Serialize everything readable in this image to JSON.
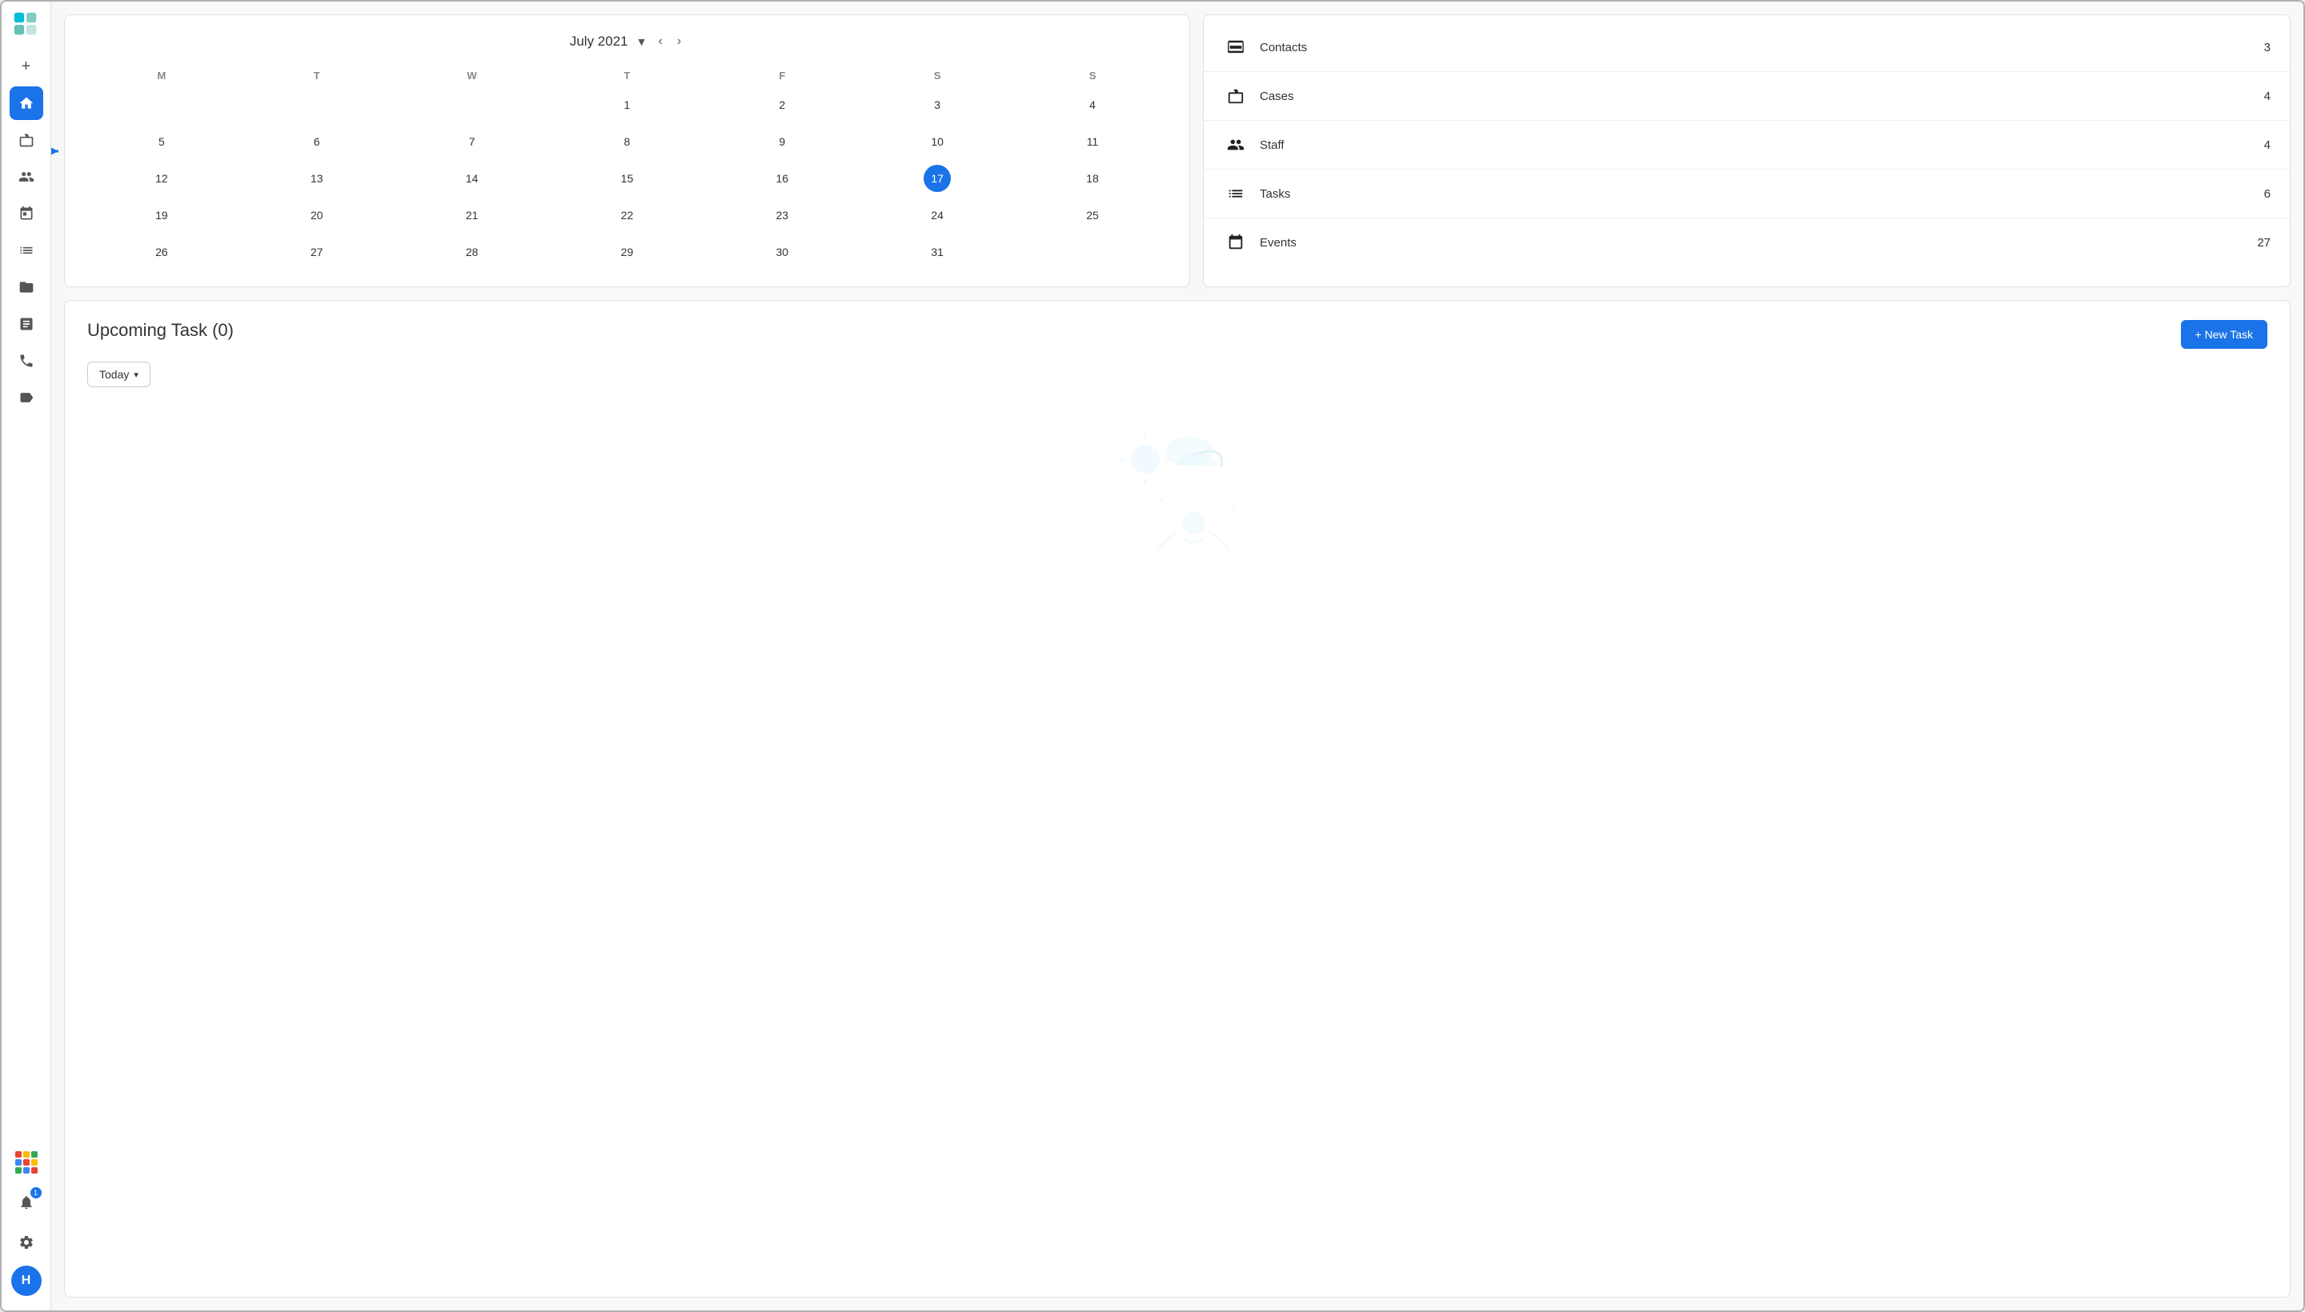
{
  "app": {
    "logo_alt": "App Logo"
  },
  "sidebar": {
    "items": [
      {
        "id": "add",
        "icon": "+",
        "label": "Add",
        "active": false
      },
      {
        "id": "home",
        "icon": "⌂",
        "label": "Home",
        "active": true
      },
      {
        "id": "briefcase",
        "icon": "💼",
        "label": "Briefcase",
        "active": false
      },
      {
        "id": "contacts",
        "icon": "👥",
        "label": "Contacts",
        "active": false
      },
      {
        "id": "calendar",
        "icon": "📅",
        "label": "Calendar",
        "active": false
      },
      {
        "id": "tasks",
        "icon": "☰",
        "label": "Tasks",
        "active": false
      },
      {
        "id": "folder",
        "icon": "📁",
        "label": "Folder",
        "active": false
      },
      {
        "id": "notes",
        "icon": "📋",
        "label": "Notes",
        "active": false
      },
      {
        "id": "phone",
        "icon": "📞",
        "label": "Phone",
        "active": false
      },
      {
        "id": "tag",
        "icon": "🏷",
        "label": "Tag",
        "active": false
      }
    ],
    "bottom": {
      "grid_label": "Apps Grid",
      "notification_label": "Notifications",
      "notification_count": "1",
      "settings_label": "Settings",
      "avatar_label": "H",
      "avatar_letter": "H"
    }
  },
  "calendar": {
    "title": "July 2021",
    "dropdown_arrow": "▼",
    "nav_prev": "‹",
    "nav_next": "›",
    "day_headers": [
      "M",
      "T",
      "W",
      "T",
      "F",
      "S",
      "S"
    ],
    "weeks": [
      [
        null,
        null,
        null,
        "1",
        "2",
        "3",
        "4"
      ],
      [
        "5",
        "6",
        "7",
        "8",
        "9",
        "10",
        "11"
      ],
      [
        "12",
        "13",
        "14",
        "15",
        "16",
        "17",
        "18"
      ],
      [
        "19",
        "20",
        "21",
        "22",
        "23",
        "24",
        "25"
      ],
      [
        "26",
        "27",
        "28",
        "29",
        "30",
        "31",
        null
      ]
    ],
    "today": "17"
  },
  "stats": {
    "items": [
      {
        "id": "contacts",
        "label": "Contacts",
        "count": "3"
      },
      {
        "id": "cases",
        "label": "Cases",
        "count": "4"
      },
      {
        "id": "staff",
        "label": "Staff",
        "count": "4"
      },
      {
        "id": "tasks",
        "label": "Tasks",
        "count": "6"
      },
      {
        "id": "events",
        "label": "Events",
        "count": "27"
      }
    ]
  },
  "tasks": {
    "title": "Upcoming Task (0)",
    "new_task_label": "+ New Task",
    "filter_label": "Today",
    "filter_arrow": "▾",
    "empty_state": true
  },
  "colors": {
    "accent": "#1a73e8",
    "sidebar_bg": "#ffffff",
    "card_bg": "#ffffff",
    "today_bg": "#1a73e8"
  }
}
